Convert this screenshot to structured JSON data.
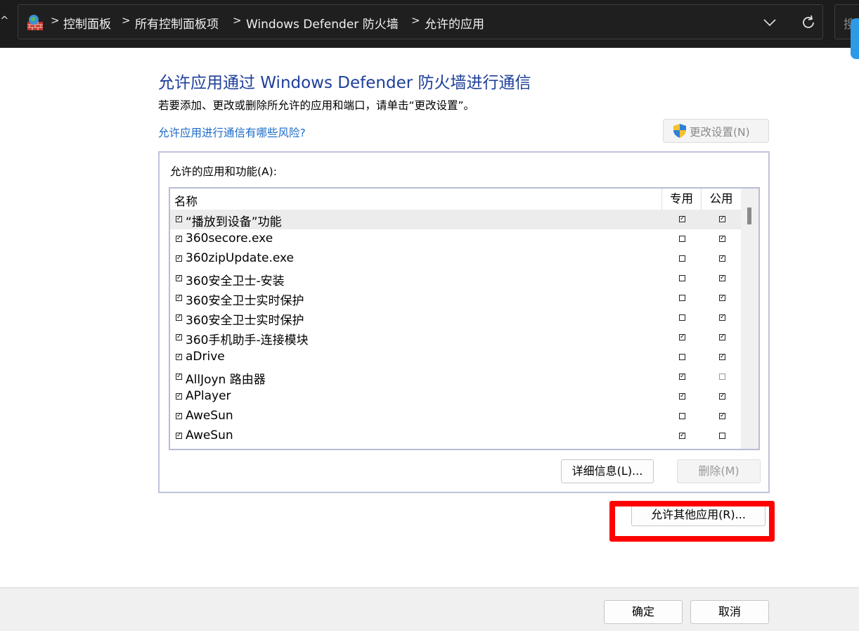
{
  "address_bar": {
    "crumbs": [
      "控制面板",
      "所有控制面板项",
      "Windows Defender 防火墙",
      "允许的应用"
    ],
    "search_placeholder": "搜"
  },
  "main": {
    "title": "允许应用通过 Windows Defender 防火墙进行通信",
    "description": "若要添加、更改或删除所允许的应用和端口，请单击“更改设置”。",
    "risk_link": "允许应用进行通信有哪些风险?",
    "change_settings_label": "更改设置(N)"
  },
  "apps_group": {
    "label": "允许的应用和功能(A):",
    "columns": {
      "name": "名称",
      "private": "专用",
      "public": "公用"
    },
    "rows": [
      {
        "name": "“播放到设备”功能",
        "enabled": true,
        "private": true,
        "public": true
      },
      {
        "name": "360secore.exe",
        "enabled": true,
        "private": false,
        "public": true
      },
      {
        "name": "360zipUpdate.exe",
        "enabled": true,
        "private": false,
        "public": true
      },
      {
        "name": "360安全卫士-安装",
        "enabled": true,
        "private": false,
        "public": true
      },
      {
        "name": "360安全卫士实时保护",
        "enabled": true,
        "private": false,
        "public": true
      },
      {
        "name": "360安全卫士实时保护",
        "enabled": true,
        "private": false,
        "public": true
      },
      {
        "name": "360手机助手-连接模块",
        "enabled": true,
        "private": true,
        "public": true
      },
      {
        "name": "aDrive",
        "enabled": true,
        "private": false,
        "public": true
      },
      {
        "name": "AllJoyn 路由器",
        "enabled": true,
        "private": true,
        "public": false
      },
      {
        "name": "APlayer",
        "enabled": true,
        "private": true,
        "public": true
      },
      {
        "name": "AweSun",
        "enabled": true,
        "private": false,
        "public": true
      },
      {
        "name": "AweSun",
        "enabled": true,
        "private": true,
        "public": false
      }
    ],
    "details_label": "详细信息(L)...",
    "delete_label": "删除(M)"
  },
  "allow_other_label": "允许其他应用(R)...",
  "footer": {
    "ok_label": "确定",
    "cancel_label": "取消"
  }
}
